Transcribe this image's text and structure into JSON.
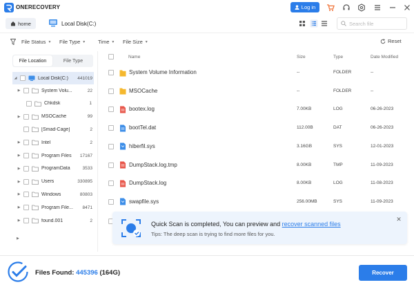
{
  "app": {
    "name": "ONERECOVERY",
    "login_label": "Log in"
  },
  "titlebar_icons": [
    "cart-icon",
    "headset-icon",
    "gear-icon",
    "menu-icon",
    "minimize-icon",
    "close-icon"
  ],
  "nav": {
    "home_label": "home",
    "drive_label": "Local Disk(C:)",
    "search_placeholder": "Search file"
  },
  "filters": [
    {
      "label": "File Status"
    },
    {
      "label": "File Type"
    },
    {
      "label": "Time"
    },
    {
      "label": "File Size"
    }
  ],
  "reset_label": "Reset",
  "sidebar": {
    "tabs": [
      "File Location",
      "File Type"
    ],
    "root": {
      "label": "Local Disk(C:)",
      "count": "441019"
    },
    "items": [
      {
        "label": "System Volu...",
        "count": "22",
        "expandable": true,
        "level": 1
      },
      {
        "label": "Chkdsk",
        "count": "1",
        "expandable": false,
        "level": 2
      },
      {
        "label": "MSOCache",
        "count": "99",
        "expandable": true,
        "level": 1
      },
      {
        "label": "[Smad-Cage]",
        "count": "2",
        "expandable": false,
        "level": 1
      },
      {
        "label": "Intel",
        "count": "2",
        "expandable": true,
        "level": 1
      },
      {
        "label": "Program Files",
        "count": "17167",
        "expandable": true,
        "level": 1
      },
      {
        "label": "ProgramData",
        "count": "3533",
        "expandable": true,
        "level": 1
      },
      {
        "label": "Users",
        "count": "330895",
        "expandable": true,
        "level": 1
      },
      {
        "label": "Windows",
        "count": "80803",
        "expandable": true,
        "level": 1
      },
      {
        "label": "Program File...",
        "count": "8471",
        "expandable": true,
        "level": 1
      },
      {
        "label": "found.001",
        "count": "2",
        "expandable": true,
        "level": 1
      }
    ]
  },
  "table": {
    "columns": {
      "name": "Name",
      "size": "Size",
      "type": "Type",
      "date": "Date Modified"
    },
    "rows": [
      {
        "name": "System Volume Information",
        "size": "--",
        "type": "FOLDER",
        "date": "--",
        "icon": "folder"
      },
      {
        "name": "MSOCache",
        "size": "--",
        "type": "FOLDER",
        "date": "--",
        "icon": "folder"
      },
      {
        "name": "bootex.log",
        "size": "7.00KB",
        "type": "LOG",
        "date": "06-26-2023",
        "icon": "log"
      },
      {
        "name": "bootTel.dat",
        "size": "112.00B",
        "type": "DAT",
        "date": "06-26-2023",
        "icon": "dat"
      },
      {
        "name": "hiberfil.sys",
        "size": "3.16GB",
        "type": "SYS",
        "date": "12-01-2023",
        "icon": "sys"
      },
      {
        "name": "DumpStack.log.tmp",
        "size": "8.00KB",
        "type": "TMP",
        "date": "11-09-2023",
        "icon": "log"
      },
      {
        "name": "DumpStack.log",
        "size": "8.00KB",
        "type": "LOG",
        "date": "11-08-2023",
        "icon": "log"
      },
      {
        "name": "swapfile.sys",
        "size": "256.00MB",
        "type": "SYS",
        "date": "11-09-2023",
        "icon": "sys"
      }
    ]
  },
  "toast": {
    "title_prefix": "Quick Scan is completed, You can preview and ",
    "title_link": "recover scanned files",
    "subtitle": "Tips: The deep scan is trying to find more files for you."
  },
  "footer": {
    "found_label": "Files Found:",
    "found_count": "445396",
    "found_size": "(164G)",
    "recover_label": "Recover"
  },
  "colors": {
    "accent": "#2b7de9",
    "folder": "#f5b82e",
    "log": "#e8574b",
    "sys": "#3d8ee8"
  }
}
